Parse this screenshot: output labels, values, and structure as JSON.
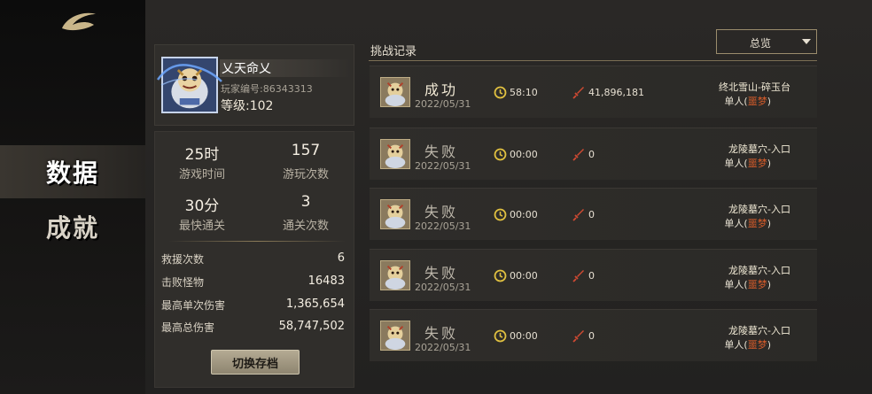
{
  "nav": {
    "items": [
      {
        "label": "数据",
        "active": true
      },
      {
        "label": "成就",
        "active": false
      }
    ]
  },
  "profile": {
    "name": "乂天命乂",
    "player_id": "玩家编号:86343313",
    "level": "等级:102"
  },
  "stats": {
    "play_time_value": "25时",
    "play_time_label": "游戏时间",
    "play_count_value": "157",
    "play_count_label": "游玩次数",
    "fastest_value": "30分",
    "fastest_label": "最快通关",
    "clear_count_value": "3",
    "clear_count_label": "通关次数",
    "details": [
      {
        "label": "救援次数",
        "value": "6"
      },
      {
        "label": "击败怪物",
        "value": "16483"
      },
      {
        "label": "最高单次伤害",
        "value": "1,365,654"
      },
      {
        "label": "最高总伤害",
        "value": "58,747,502"
      }
    ],
    "switch_button": "切换存档"
  },
  "records": {
    "title": "挑战记录",
    "filter": "总览",
    "rows": [
      {
        "result": "成功",
        "date": "2022/05/31",
        "time": "58:10",
        "damage": "41,896,181",
        "location": "终北雪山-碎玉台",
        "mode": "单人(",
        "difficulty": "噩梦",
        "mode_end": ")"
      },
      {
        "result": "失败",
        "date": "2022/05/31",
        "time": "00:00",
        "damage": "0",
        "location": "龙陵墓穴-入口",
        "mode": "单人(",
        "difficulty": "噩梦",
        "mode_end": ")"
      },
      {
        "result": "失败",
        "date": "2022/05/31",
        "time": "00:00",
        "damage": "0",
        "location": "龙陵墓穴-入口",
        "mode": "单人(",
        "difficulty": "噩梦",
        "mode_end": ")"
      },
      {
        "result": "失败",
        "date": "2022/05/31",
        "time": "00:00",
        "damage": "0",
        "location": "龙陵墓穴-入口",
        "mode": "单人(",
        "difficulty": "噩梦",
        "mode_end": ")"
      },
      {
        "result": "失败",
        "date": "2022/05/31",
        "time": "00:00",
        "damage": "0",
        "location": "龙陵墓穴-入口",
        "mode": "单人(",
        "difficulty": "噩梦",
        "mode_end": ")"
      }
    ]
  },
  "colors": {
    "accent_gold": "#9a8c6c",
    "difficulty_red": "#d25a2a",
    "clock_yellow": "#e0c040",
    "sword_red": "#d04a32"
  }
}
